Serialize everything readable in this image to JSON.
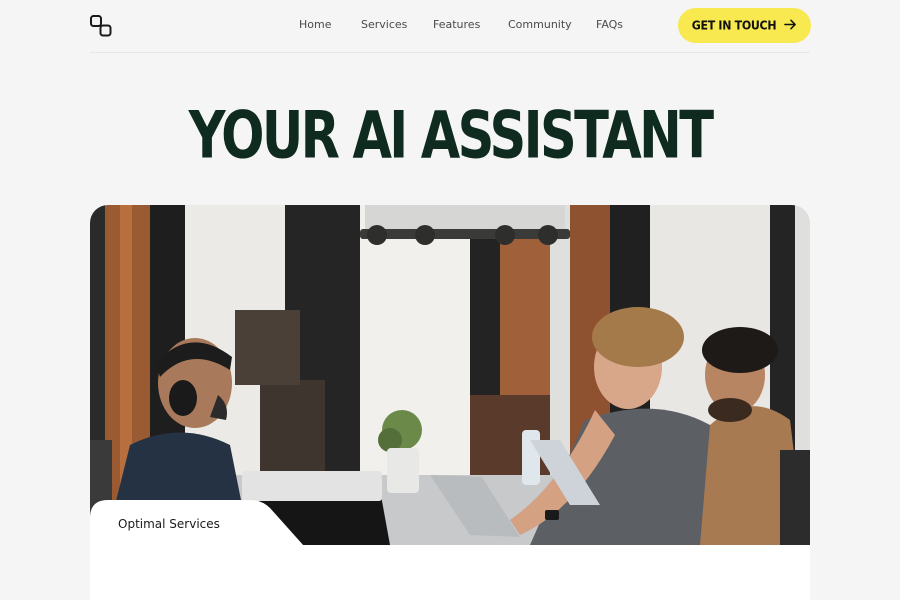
{
  "header": {
    "logo_icon": "linked-squares-icon",
    "nav": [
      {
        "label": "Home"
      },
      {
        "label": "Services"
      },
      {
        "label": "Features"
      },
      {
        "label": "Community"
      },
      {
        "label": "FAQs"
      }
    ],
    "cta_label": "GET IN TOUCH",
    "cta_icon": "arrow-right-icon",
    "cta_color": "#f7e94f"
  },
  "hero": {
    "title": "YOUR AI ASSISTANT",
    "title_color": "#0f2a1f"
  },
  "photo": {
    "tab_label": "Optimal Services"
  }
}
